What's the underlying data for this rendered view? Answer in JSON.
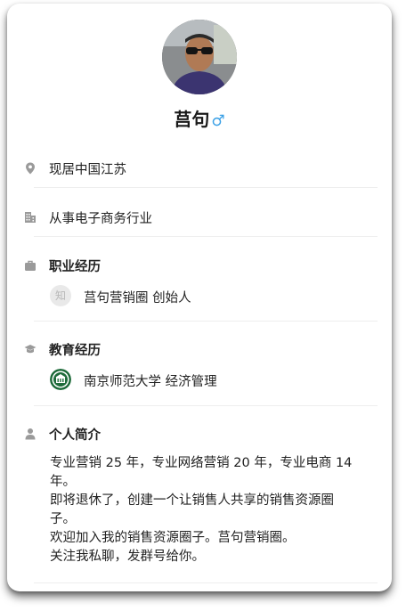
{
  "profile": {
    "name": "莒句",
    "gender_symbol": "♂"
  },
  "info": {
    "location": "现居中国江苏",
    "industry": "从事电子商务行业"
  },
  "career": {
    "title": "职业经历",
    "logo_char": "知",
    "entry": "莒句营销圈  创始人"
  },
  "education": {
    "title": "教育经历",
    "entry": "南京师范大学  经济管理"
  },
  "bio": {
    "title": "个人简介",
    "lines": [
      "专业营销 25 年，专业网络营销 20 年，专业电商 14",
      "年。",
      "即将退休了，创建一个让销售人共享的销售资源圈",
      "子。",
      "欢迎加入我的销售资源圈子。莒句营销圈。",
      "关注我私聊，发群号给你。"
    ]
  },
  "colors": {
    "icon_gray": "#9a9a9a",
    "gender_blue": "#3aa0e6",
    "university_green": "#1e6b3a"
  }
}
